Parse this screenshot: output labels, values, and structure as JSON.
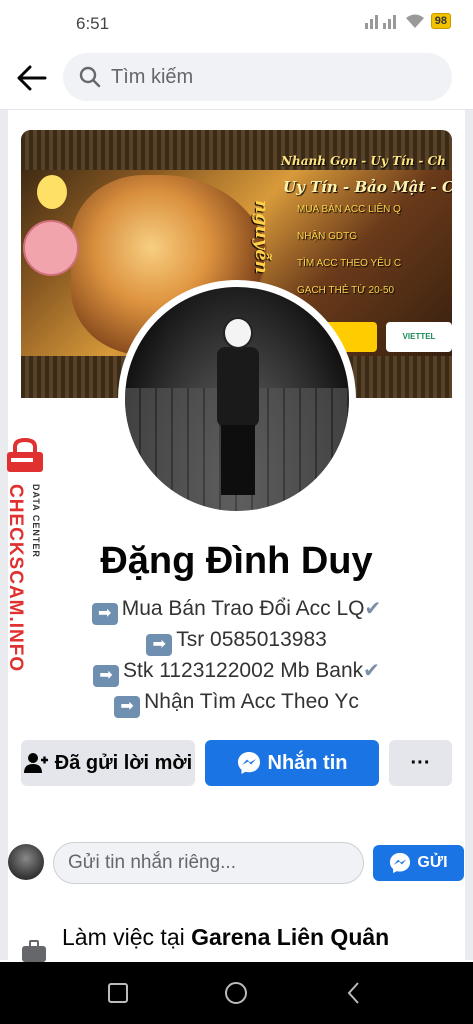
{
  "status_bar": {
    "time": "6:51",
    "battery": "98"
  },
  "search": {
    "placeholder": "Tìm kiếm"
  },
  "cover": {
    "slogan_top": "Nhanh Gọn - Uy Tín - Ch",
    "slogan_mid": "Uy Tín - Bảo Mật - Ch",
    "services": [
      "MUA BÁN ACC LIÊN Q",
      "NHẬN GDTG",
      "TÌM ACC THEO YÊU C",
      "GẠCH THẺ TỪ 20-50"
    ],
    "vertical_word": "nguyễn",
    "carrier_badge": "VIETTEL"
  },
  "watermark": {
    "main": "CHECKSCAM.INFO",
    "sub": "DATA CENTER"
  },
  "profile": {
    "name": "Đặng Đình Duy",
    "bio": [
      "Mua Bán Trao Đổi Acc LQ",
      "Tsr 0585013983",
      "Stk 1123122002 Mb Bank",
      "Nhận Tìm Acc Theo Yc"
    ]
  },
  "actions": {
    "friend_request_label": "Đã gửi lời mời",
    "message_label": "Nhắn tin",
    "more_label": "···"
  },
  "composer": {
    "placeholder": "Gửi tin nhắn riêng...",
    "send_label": "GỬI"
  },
  "work": {
    "prefix": "Làm việc tại ",
    "company": "Garena Liên Quân"
  },
  "colors": {
    "primary_blue": "#1b74e4",
    "button_gray": "#e4e6eb",
    "watermark_red": "#e03030"
  }
}
